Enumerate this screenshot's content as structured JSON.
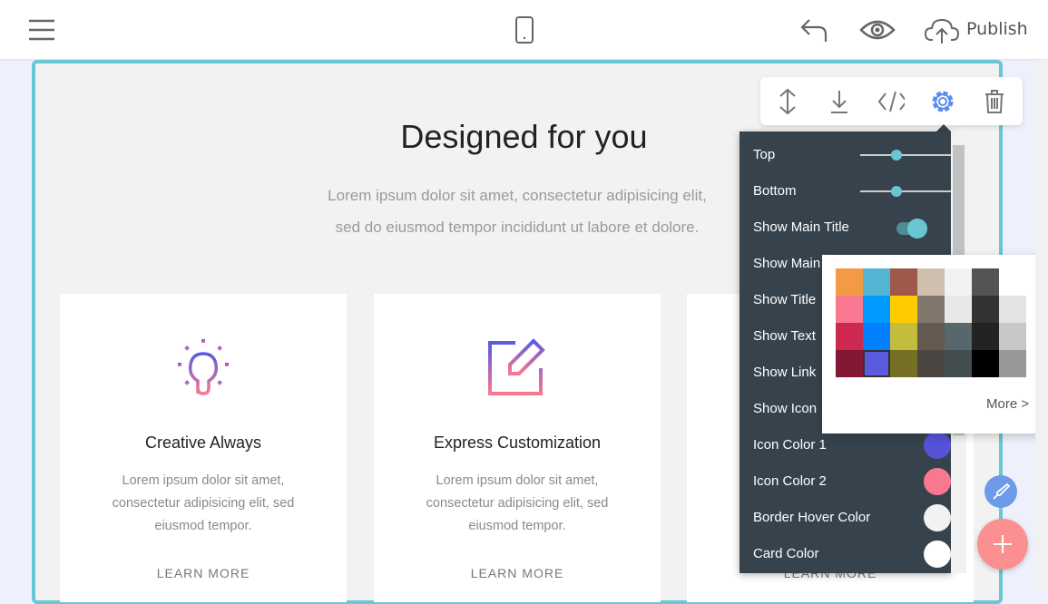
{
  "topbar": {
    "publish_label": "Publish"
  },
  "hero": {
    "title": "Designed for you",
    "subtitle_line1": "Lorem ipsum dolor sit amet, consectetur adipisicing elit,",
    "subtitle_line2": "sed do eiusmod tempor incididunt ut labore et dolore."
  },
  "cards": [
    {
      "title": "Creative Always",
      "text": "Lorem ipsum dolor sit amet, consectetur adipisicing elit, sed eiusmod tempor.",
      "link": "LEARN MORE",
      "icon": "lightbulb-icon"
    },
    {
      "title": "Express Customization",
      "text": "Lorem ipsum dolor sit amet, consectetur adipisicing elit, sed eiusmod tempor.",
      "link": "LEARN MORE",
      "icon": "edit-icon"
    },
    {
      "title": "",
      "text": "",
      "link": "LEARN MORE",
      "icon": ""
    }
  ],
  "toolbar": {
    "icons": [
      "move-vertical-icon",
      "download-icon",
      "code-icon",
      "gear-icon",
      "trash-icon"
    ]
  },
  "settings": {
    "top_label": "Top",
    "top_value": 0.4,
    "bottom_label": "Bottom",
    "bottom_value": 0.4,
    "rows": [
      "Show Main Title",
      "Show Main",
      "Show Title",
      "Show Text",
      "Show Link",
      "Show Icon"
    ],
    "show_main_title_on": true,
    "icon_color_1_label": "Icon Color 1",
    "icon_color_1": "#5552d8",
    "icon_color_2_label": "Icon Color 2",
    "icon_color_2": "#f7788f",
    "border_hover_label": "Border Hover Color",
    "border_hover": "#f2f2f2",
    "card_color_label": "Card Color",
    "card_color": "#ffffff"
  },
  "palette": {
    "rows": [
      [
        "#f49a45",
        "#56b4d3",
        "#a0584a",
        "#cfbfaf",
        "#f2f2f2",
        "#545454"
      ],
      [
        "#f7788f",
        "#009bff",
        "#ffcc00",
        "#82776d",
        "#e8e8e8",
        "#333333",
        "#e3e3e3"
      ],
      [
        "#cc2850",
        "#0080ff",
        "#c4bc3c",
        "#645a50",
        "#57676b",
        "#232323",
        "#c8c8c8"
      ],
      [
        "#811733",
        "#5b5be0",
        "#767024",
        "#4c4642",
        "#424d50",
        "#000000",
        "#989898"
      ]
    ],
    "selected": "#5b5be0",
    "more_label": "More >"
  },
  "colors": {
    "accent": "#6ac6d3",
    "panel": "#37434c",
    "active_icon": "#5b8df0"
  }
}
